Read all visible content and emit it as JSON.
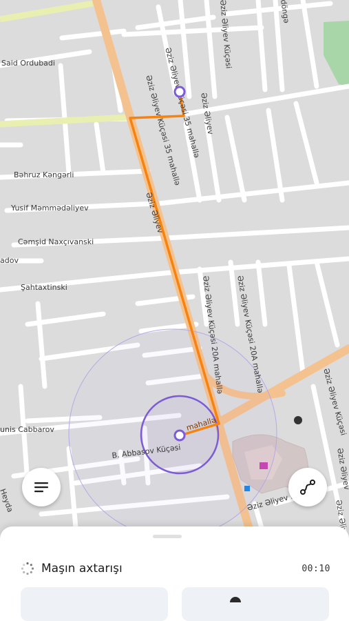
{
  "map": {
    "street_labels": [
      "Said Ordubadi",
      "Bəhruz Kəngərli",
      "Yusif Məmmədəliyev",
      "Cəmşid Naxçıvanski",
      "adov",
      "Şahtaxtinski",
      "unis Cabbarov",
      "B. Abbasov Küçəsi",
      "mahallə",
      "Əziz Əliyev Küçəsi 35 mahallə",
      "Əziz Əliyev Küçəsi 35 mahallə",
      "Əziz Əliyev",
      "Əziz Əliyev Küçəsi 20A mahallə",
      "Əziz Əliyev Küçəsi 20A mahallə",
      "Əziz Əliyev Küçəsi",
      "Əziz Əliyev",
      "döngə",
      "Əziz Əliyev Küçəsi",
      "Əziz Əliyev",
      "Əziz Əliyev Küçəsi",
      "Əziz Əliyev",
      "Heyda"
    ],
    "route_color": "#f7820d",
    "marker_color": "#7c5cd6"
  },
  "menu_button": {
    "icon": "hamburger-menu-icon"
  },
  "route_button": {
    "icon": "route-icon"
  },
  "bottom_sheet": {
    "status_icon": "spinner-icon",
    "status_text": "Maşın axtarışı",
    "timer": "00:10"
  }
}
